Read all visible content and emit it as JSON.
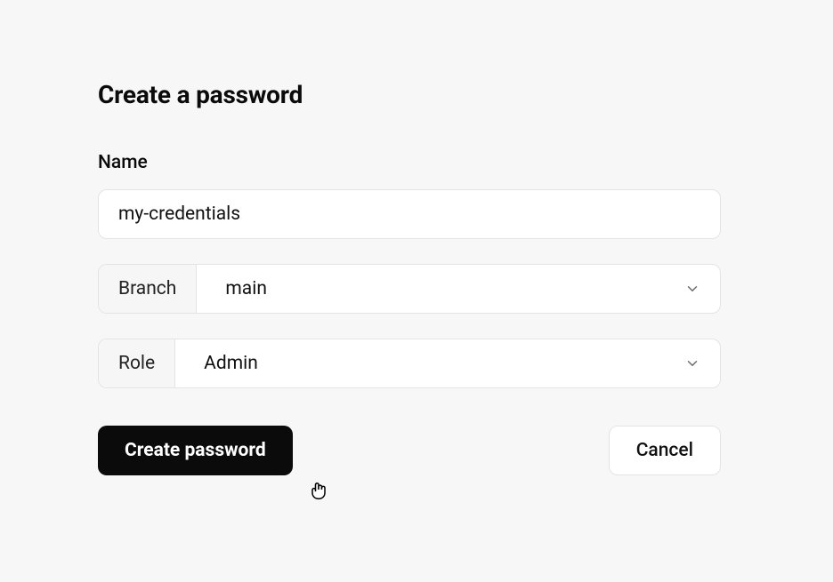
{
  "title": "Create a password",
  "fields": {
    "name": {
      "label": "Name",
      "value": "my-credentials"
    },
    "branch": {
      "label": "Branch",
      "value": "main"
    },
    "role": {
      "label": "Role",
      "value": "Admin"
    }
  },
  "buttons": {
    "primary": "Create password",
    "secondary": "Cancel"
  }
}
